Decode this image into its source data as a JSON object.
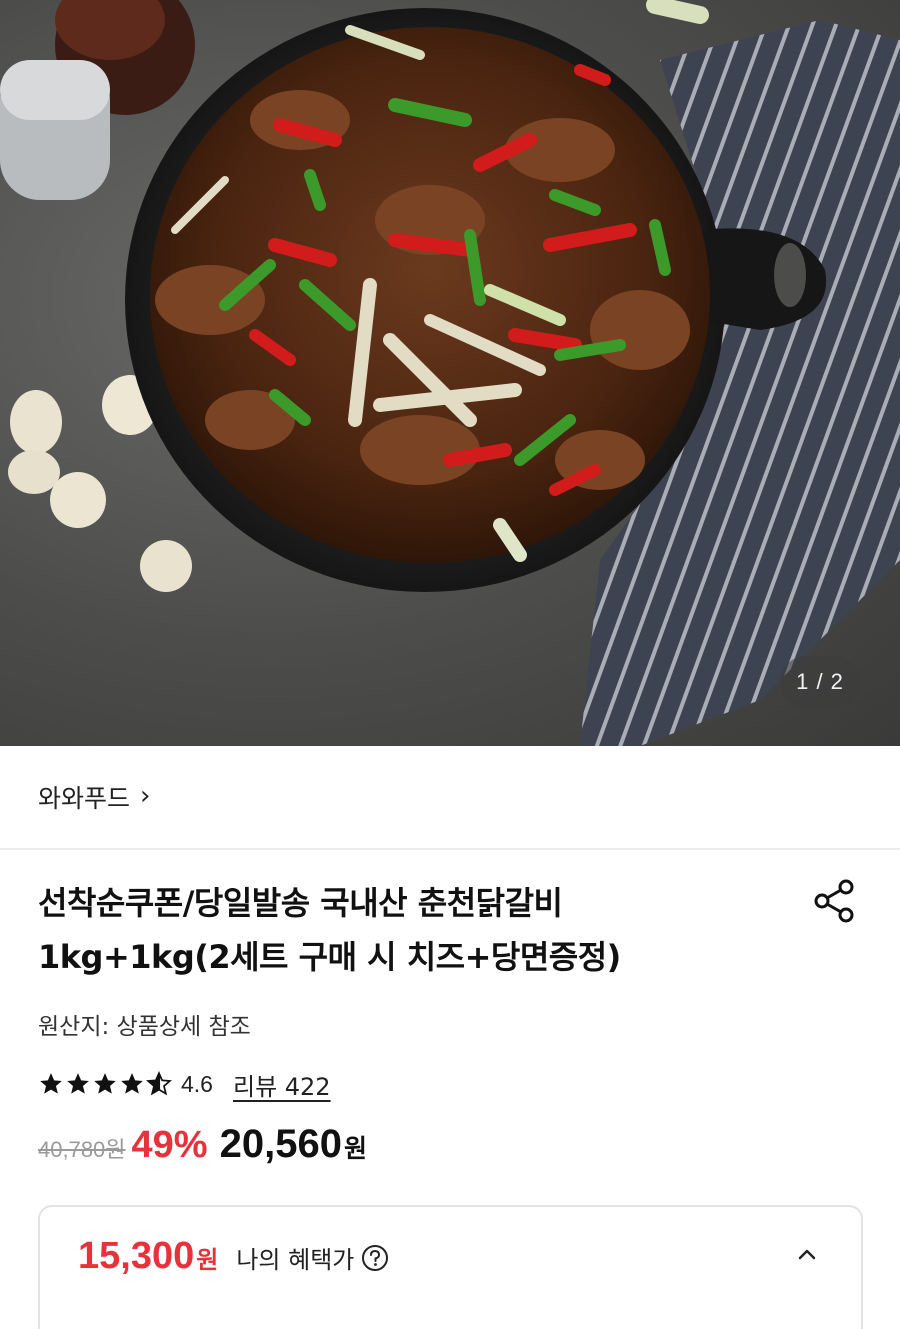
{
  "hero": {
    "counter": "1 / 2"
  },
  "seller": {
    "name": "와와푸드",
    "chevron": "›"
  },
  "product": {
    "title_line1": "선착순쿠폰/당일발송 국내산 춘천닭갈비",
    "title_line2": "1kg+1kg(2세트 구매 시 치즈+당면증정)",
    "origin": "원산지: 상품상세 참조",
    "rating": "4.6",
    "rating_stars": 4.6,
    "reviews": "리뷰 422"
  },
  "price": {
    "original": "40,780원",
    "discount": "49%",
    "final": "20,560",
    "currency": "원"
  },
  "benefit": {
    "price": "15,300",
    "currency": "원",
    "label": "나의 혜택가"
  },
  "colors": {
    "accent_red": "#e5323b",
    "text": "#111111",
    "muted": "#9a9a9a"
  },
  "icons": {
    "share": "share-icon",
    "help": "question-circle-icon",
    "collapse": "chevron-up-icon",
    "seller_chevron": "chevron-right-icon"
  }
}
